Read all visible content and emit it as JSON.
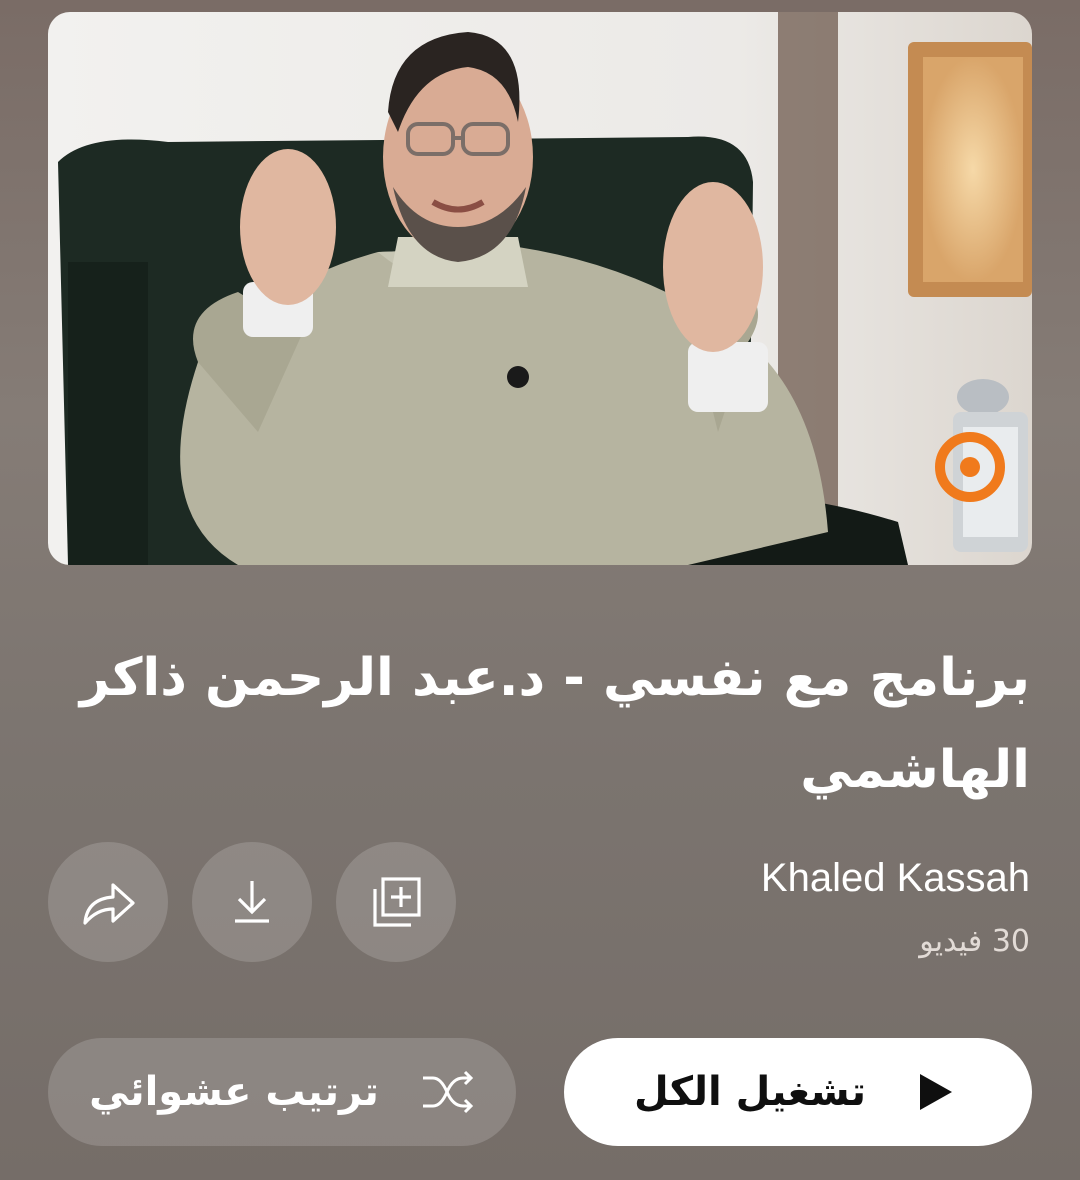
{
  "playlist": {
    "title": "برنامج مع نفسي - د.عبد الرحمن ذاكر الهاشمي",
    "owner": "Khaled Kassah",
    "video_count": "30 فيديو",
    "thumbnail_description": "Man in light-colored robe seated in dark armchair"
  },
  "actions": {
    "share_icon": "share-icon",
    "download_icon": "download-icon",
    "save_icon": "add-to-library-icon"
  },
  "buttons": {
    "play_all_label": "تشغيل الكل",
    "shuffle_label": "ترتيب عشوائي"
  },
  "colors": {
    "play_button_bg": "#ffffff",
    "secondary_button_bg": "rgba(255,255,255,0.16)",
    "background": "#7f7670"
  }
}
